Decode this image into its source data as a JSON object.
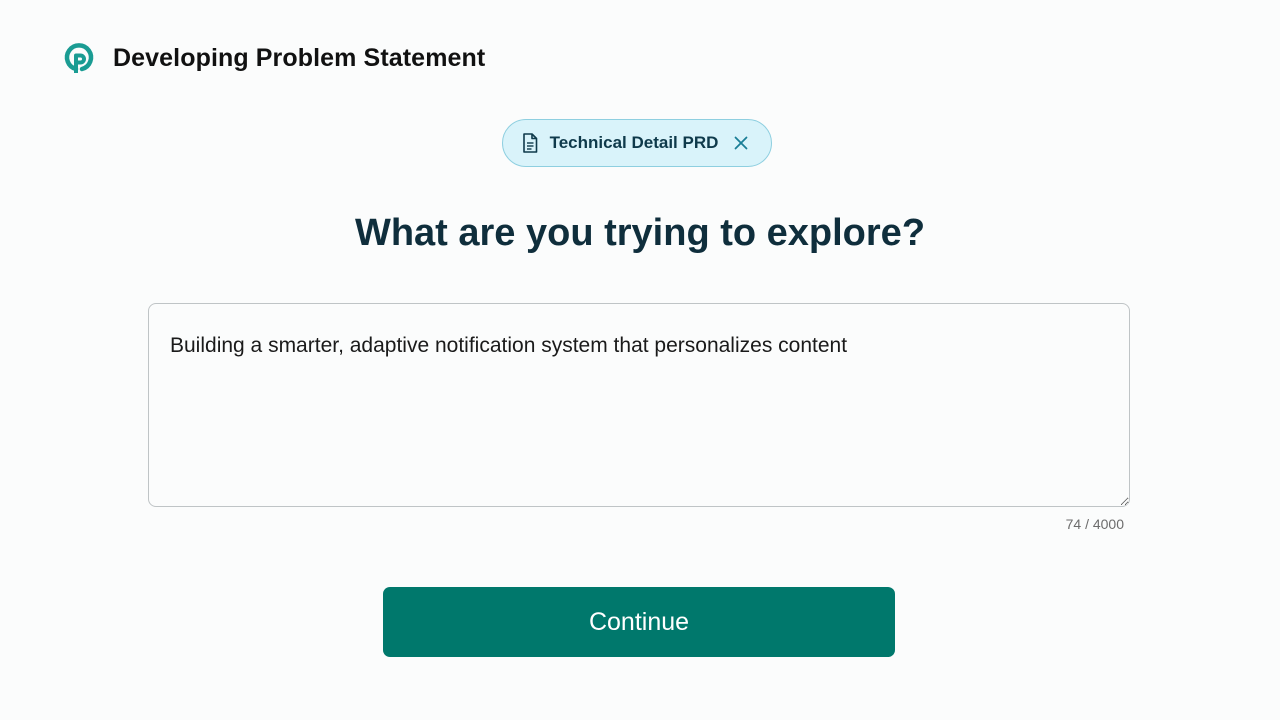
{
  "header": {
    "title": "Developing Problem Statement",
    "logo_icon": "brand-logo-icon"
  },
  "chip": {
    "label": "Technical Detail PRD",
    "icon": "document-icon",
    "close_icon": "close-icon"
  },
  "question": "What are you trying to explore?",
  "explore_input": {
    "value": "Building a smarter, adaptive notification system that personalizes content",
    "char_count": "74 / 4000"
  },
  "continue_label": "Continue",
  "colors": {
    "brand": "#1A9C93",
    "primary_button": "#00786C",
    "chip_bg": "#D9F3FA",
    "chip_border": "#8ECFE0",
    "heading": "#0F2E3C"
  }
}
